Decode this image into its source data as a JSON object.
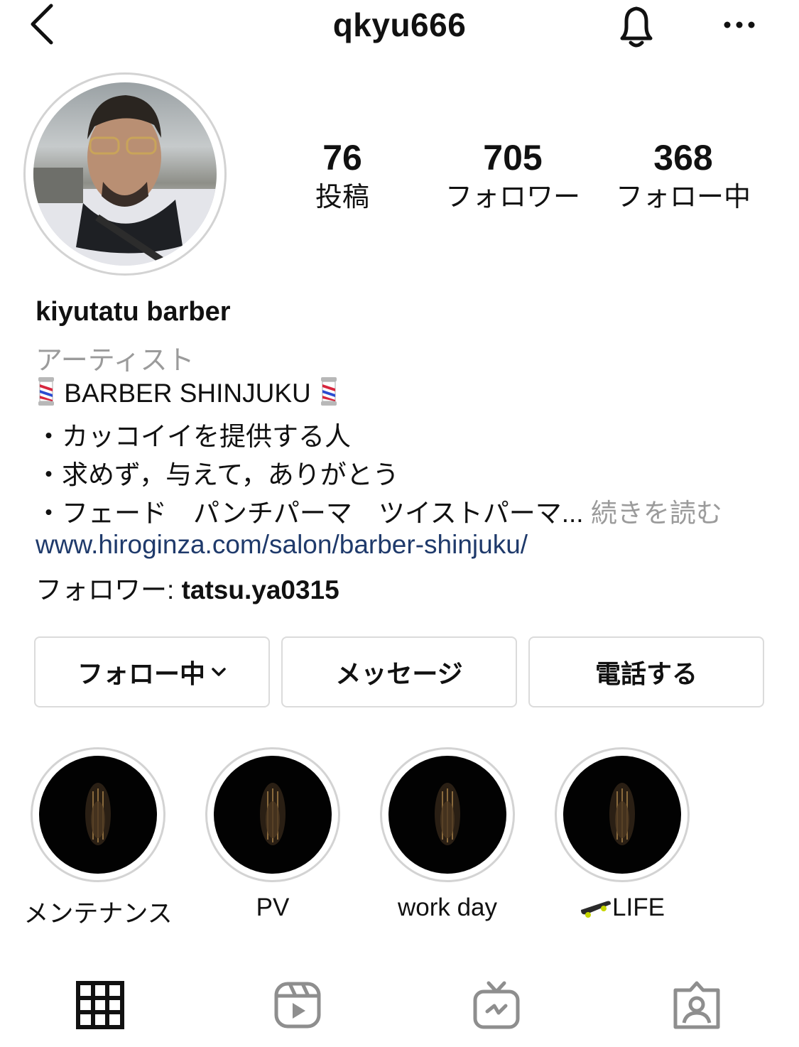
{
  "header": {
    "username": "qkyu666",
    "back_icon": "chevron-left-icon",
    "bell_icon": "bell-icon",
    "more_icon": "more-horizontal-icon"
  },
  "stats": [
    {
      "count": "76",
      "label": "投稿"
    },
    {
      "count": "705",
      "label": "フォロワー"
    },
    {
      "count": "368",
      "label": "フォロー中"
    }
  ],
  "profile": {
    "display_name": "kiyutatu barber",
    "category": "アーティスト",
    "bio_title": " BARBER SHINJUKU ",
    "bio_lines": [
      "・カッコイイを提供する人",
      "・求めず，与えて，ありがとう",
      "・フェード　パンチパーマ　ツイストパーマ..."
    ],
    "read_more": " 続きを読む",
    "website": "www.hiroginza.com/salon/barber-shinjuku/",
    "followed_by_prefix": "フォロワー: ",
    "followed_by_user": "tatsu.ya0315"
  },
  "buttons": {
    "following": "フォロー中",
    "message": "メッセージ",
    "call": "電話する"
  },
  "highlights": [
    {
      "label": "メンテナンス"
    },
    {
      "label": "PV"
    },
    {
      "label": "work day"
    },
    {
      "label": "LIFE"
    }
  ],
  "tabs": [
    {
      "icon": "grid-icon",
      "active": true
    },
    {
      "icon": "reels-icon",
      "active": false
    },
    {
      "icon": "igtv-icon",
      "active": false
    },
    {
      "icon": "tagged-icon",
      "active": false
    }
  ],
  "colors": {
    "link": "#1f3a6b",
    "muted": "#9b9b9b",
    "border": "#dbdbdb",
    "icon_inactive": "#8e8e8e"
  }
}
